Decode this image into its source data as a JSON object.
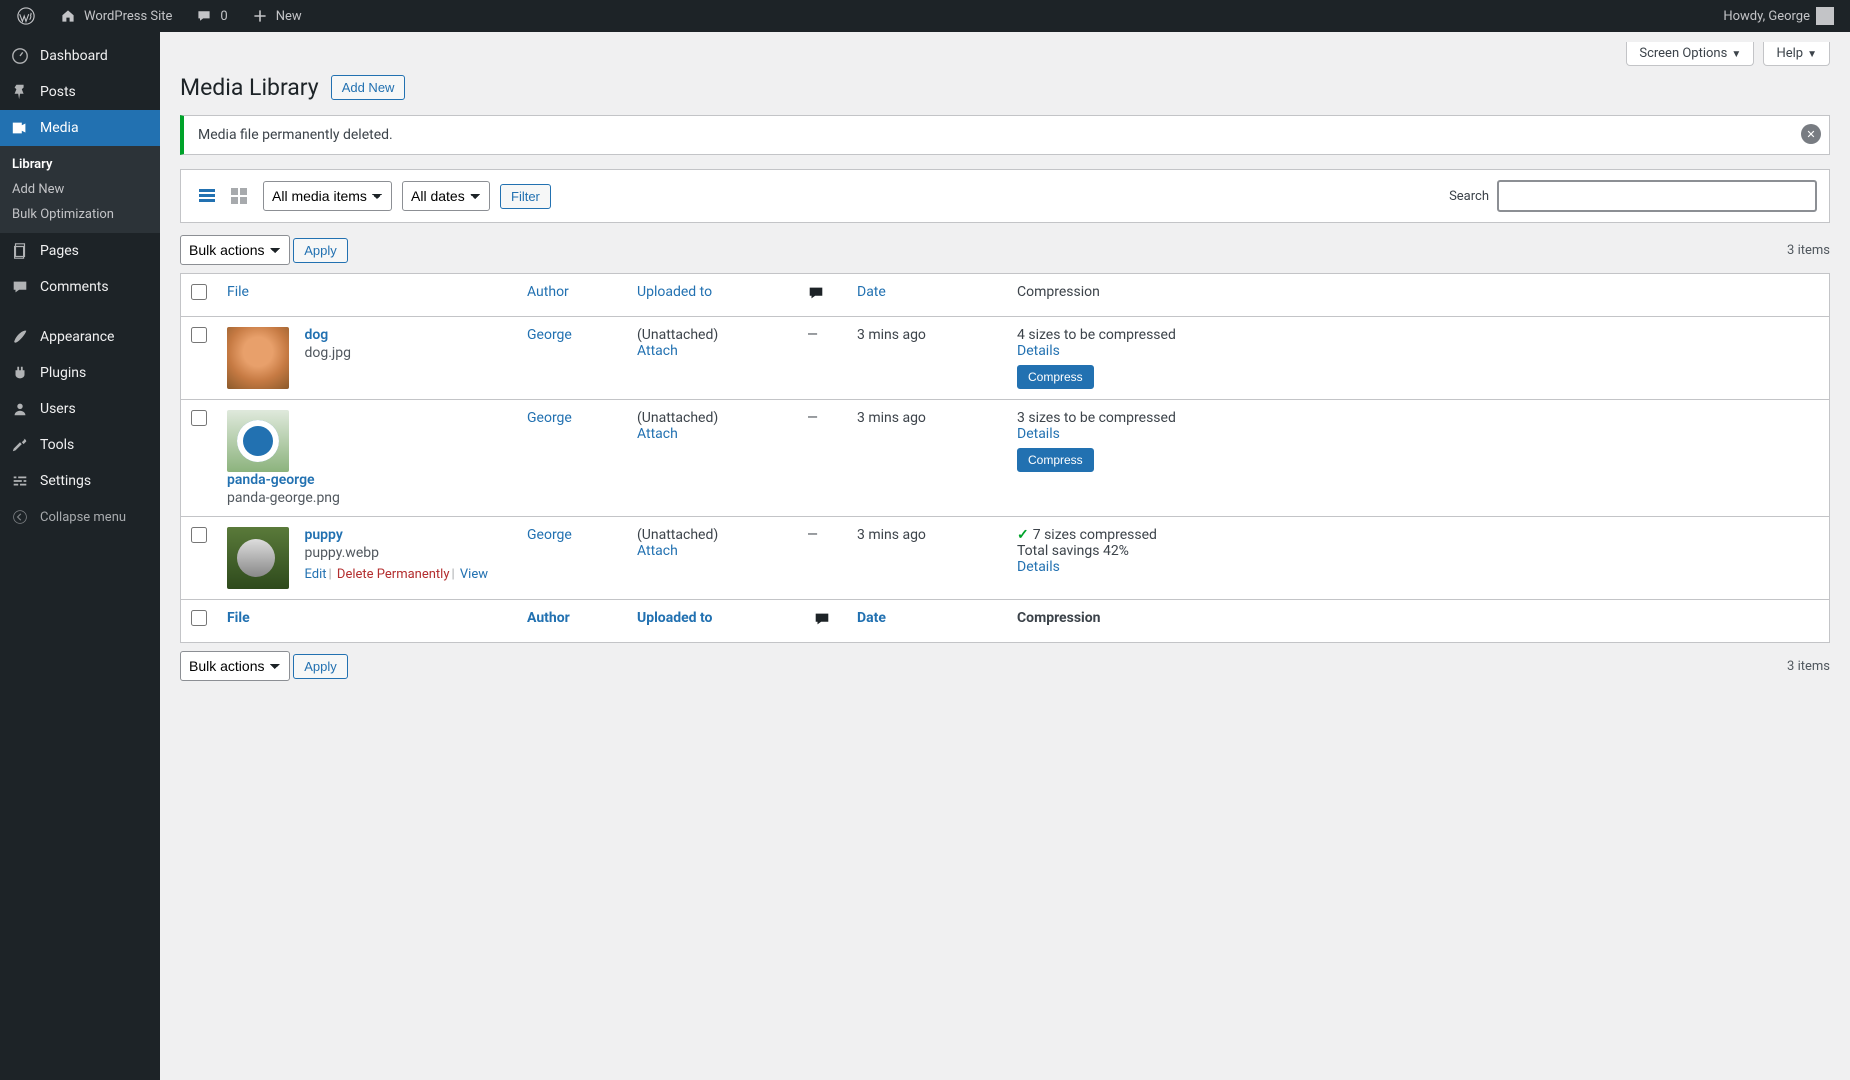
{
  "toolbar": {
    "site_name": "WordPress Site",
    "comments_count": "0",
    "new_label": "New",
    "howdy": "Howdy, George"
  },
  "sidebar": {
    "dashboard": "Dashboard",
    "posts": "Posts",
    "media": "Media",
    "media_sub": {
      "library": "Library",
      "add_new": "Add New",
      "bulk_opt": "Bulk Optimization"
    },
    "pages": "Pages",
    "comments": "Comments",
    "appearance": "Appearance",
    "plugins": "Plugins",
    "users": "Users",
    "tools": "Tools",
    "settings": "Settings",
    "collapse": "Collapse menu"
  },
  "top_tabs": {
    "screen_options": "Screen Options",
    "help": "Help"
  },
  "header": {
    "title": "Media Library",
    "add_new": "Add New"
  },
  "notice": {
    "text": "Media file permanently deleted."
  },
  "filters": {
    "media_items": "All media items",
    "dates": "All dates",
    "filter_btn": "Filter",
    "search_label": "Search"
  },
  "bulk": {
    "label": "Bulk actions",
    "apply": "Apply"
  },
  "count": "3 items",
  "columns": {
    "file": "File",
    "author": "Author",
    "uploaded": "Uploaded to",
    "date": "Date",
    "compression": "Compression"
  },
  "rows": [
    {
      "title": "dog",
      "filename": "dog.jpg",
      "author": "George",
      "uploaded": "(Unattached)",
      "attach": "Attach",
      "comments": "—",
      "date": "3 mins ago",
      "comp_line1": "4 sizes to be compressed",
      "details": "Details",
      "compress_btn": "Compress",
      "show_actions": false,
      "thumb_class": "dog"
    },
    {
      "title": "panda-george",
      "filename": "panda-george.png",
      "author": "George",
      "uploaded": "(Unattached)",
      "attach": "Attach",
      "comments": "—",
      "date": "3 mins ago",
      "comp_line1": "3 sizes to be compressed",
      "details": "Details",
      "compress_btn": "Compress",
      "show_actions": false,
      "thumb_class": "panda"
    },
    {
      "title": "puppy",
      "filename": "puppy.webp",
      "author": "George",
      "uploaded": "(Unattached)",
      "attach": "Attach",
      "comments": "—",
      "date": "3 mins ago",
      "comp_line1": "7 sizes compressed",
      "comp_line2": "Total savings 42%",
      "details": "Details",
      "show_check": true,
      "show_actions": true,
      "edit": "Edit",
      "delete": "Delete Permanently",
      "view": "View",
      "thumb_class": "puppy"
    }
  ]
}
